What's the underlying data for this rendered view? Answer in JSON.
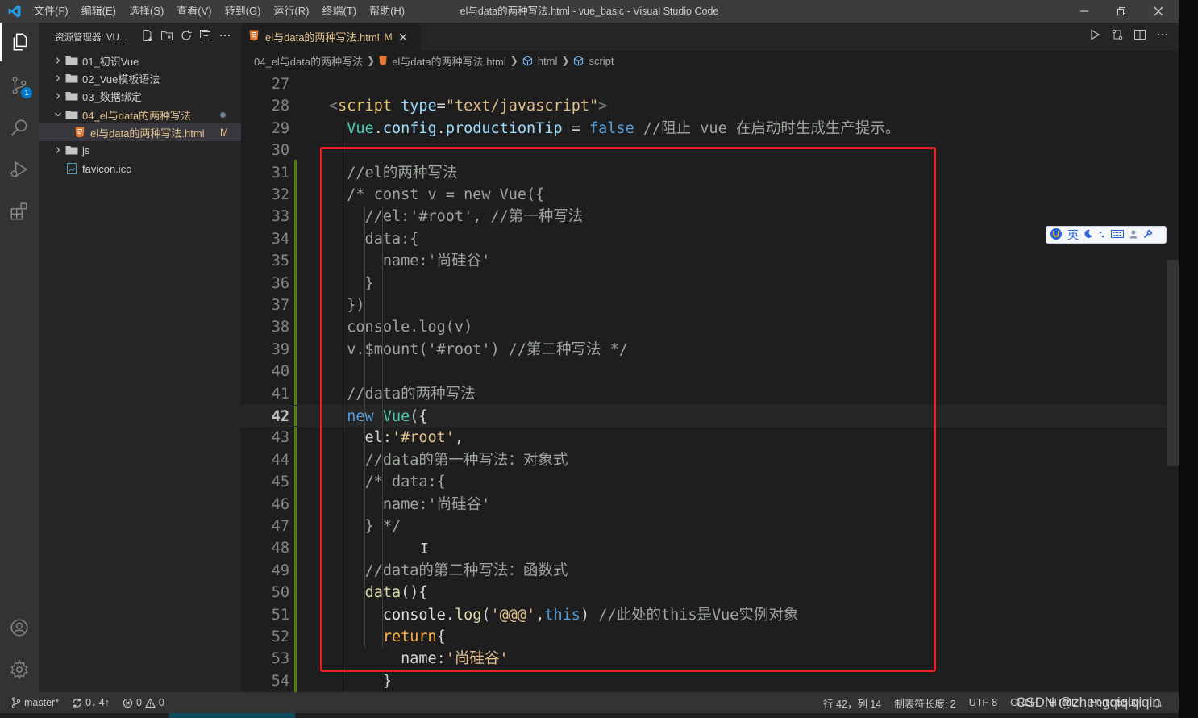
{
  "titlebar": {
    "menus": [
      "文件(F)",
      "编辑(E)",
      "选择(S)",
      "查看(V)",
      "转到(G)",
      "运行(R)",
      "终端(T)",
      "帮助(H)"
    ],
    "window_title": "el与data的两种写法.html - vue_basic - Visual Studio Code"
  },
  "activitybar": {
    "scm_badge": "1",
    "icons": [
      "explorer-icon",
      "source-control-icon",
      "search-icon",
      "run-debug-icon",
      "extensions-icon",
      "account-icon",
      "settings-gear-icon"
    ]
  },
  "sidebar": {
    "title": "资源管理器: VU...",
    "items": [
      {
        "label": "01_初识Vue",
        "type": "folder",
        "expanded": false
      },
      {
        "label": "02_Vue模板语法",
        "type": "folder",
        "expanded": false
      },
      {
        "label": "03_数据绑定",
        "type": "folder",
        "expanded": false
      },
      {
        "label": "04_el与data的两种写法",
        "type": "folder",
        "expanded": true
      },
      {
        "label": "el与data的两种写法.html",
        "type": "file",
        "decoration": "M"
      },
      {
        "label": "js",
        "type": "folder",
        "expanded": false
      },
      {
        "label": "favicon.ico",
        "type": "file"
      }
    ]
  },
  "tab": {
    "label": "el与data的两种写法.html",
    "modified": "M"
  },
  "breadcrumb": [
    "04_el与data的两种写法",
    "el与data的两种写法.html",
    "html",
    "script"
  ],
  "ime_toolbar": {
    "lang": "英"
  },
  "code": {
    "current_line": 42,
    "lines": [
      {
        "n": "27",
        "t": ""
      },
      {
        "n": "28",
        "t": "<script type=\"text/javascript\">"
      },
      {
        "n": "29",
        "t": "  Vue.config.productionTip = false //阻止 vue 在启动时生成生产提示。"
      },
      {
        "n": "30",
        "t": ""
      },
      {
        "n": "31",
        "t": "  //el的两种写法"
      },
      {
        "n": "32",
        "t": "  /* const v = new Vue({"
      },
      {
        "n": "33",
        "t": "    //el:'#root', //第一种写法"
      },
      {
        "n": "34",
        "t": "    data:{"
      },
      {
        "n": "35",
        "t": "      name:'尚硅谷'"
      },
      {
        "n": "36",
        "t": "    }"
      },
      {
        "n": "37",
        "t": "  })"
      },
      {
        "n": "38",
        "t": "  console.log(v)"
      },
      {
        "n": "39",
        "t": "  v.$mount('#root') //第二种写法 */"
      },
      {
        "n": "40",
        "t": ""
      },
      {
        "n": "41",
        "t": "  //data的两种写法"
      },
      {
        "n": "42",
        "t": "  new Vue({"
      },
      {
        "n": "43",
        "t": "    el:'#root',"
      },
      {
        "n": "44",
        "t": "    //data的第一种写法：对象式"
      },
      {
        "n": "45",
        "t": "    /* data:{"
      },
      {
        "n": "46",
        "t": "      name:'尚硅谷'"
      },
      {
        "n": "47",
        "t": "    } */"
      },
      {
        "n": "48",
        "t": ""
      },
      {
        "n": "49",
        "t": "    //data的第二种写法：函数式"
      },
      {
        "n": "50",
        "t": "    data(){"
      },
      {
        "n": "51",
        "t": "      console.log('@@@',this) //此处的this是Vue实例对象"
      },
      {
        "n": "52",
        "t": "      return{"
      },
      {
        "n": "53",
        "t": "        name:'尚硅谷'"
      },
      {
        "n": "54",
        "t": "      }"
      }
    ]
  },
  "statusbar": {
    "branch": "master*",
    "sync": "0↓ 4↑",
    "errors": "0",
    "warnings": "0",
    "position": "行 42，列 14",
    "tab_size": "制表符长度: 2",
    "encoding": "UTF-8",
    "eol": "CRLF",
    "language": "HTML",
    "port": "Port : 5500"
  },
  "watermark": "CSDN @zhengqiqiqiqin",
  "colors": {
    "accent_blue": "#007acc",
    "highlight_red": "#e8202a",
    "modified_yellow": "#e2c08d"
  }
}
